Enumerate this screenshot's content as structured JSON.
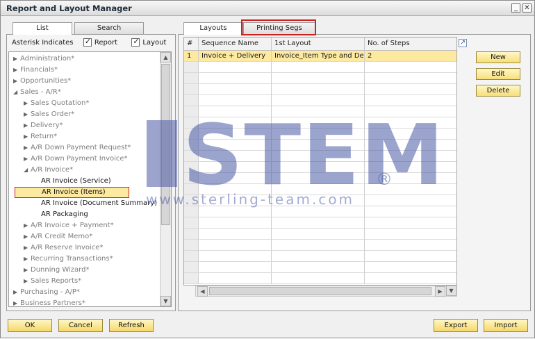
{
  "window": {
    "title": "Report and Layout Manager"
  },
  "left_tabs": {
    "list": "List",
    "search": "Search"
  },
  "asterisk": {
    "label": "Asterisk Indicates",
    "report": "Report",
    "layout": "Layout"
  },
  "tree": [
    {
      "label": "Administration*",
      "level": 0,
      "arrow": "▶",
      "tone": "grey"
    },
    {
      "label": "Financials*",
      "level": 0,
      "arrow": "▶",
      "tone": "grey"
    },
    {
      "label": "Opportunities*",
      "level": 0,
      "arrow": "▶",
      "tone": "grey"
    },
    {
      "label": "Sales - A/R*",
      "level": 0,
      "arrow": "◢",
      "tone": "grey"
    },
    {
      "label": "Sales Quotation*",
      "level": 1,
      "arrow": "▶",
      "tone": "grey"
    },
    {
      "label": "Sales Order*",
      "level": 1,
      "arrow": "▶",
      "tone": "grey"
    },
    {
      "label": "Delivery*",
      "level": 1,
      "arrow": "▶",
      "tone": "grey"
    },
    {
      "label": "Return*",
      "level": 1,
      "arrow": "▶",
      "tone": "grey"
    },
    {
      "label": "A/R Down Payment Request*",
      "level": 1,
      "arrow": "▶",
      "tone": "grey"
    },
    {
      "label": "A/R Down Payment Invoice*",
      "level": 1,
      "arrow": "▶",
      "tone": "grey"
    },
    {
      "label": "A/R Invoice*",
      "level": 1,
      "arrow": "◢",
      "tone": "grey"
    },
    {
      "label": "AR Invoice (Service)",
      "level": 2,
      "arrow": "",
      "tone": "dark"
    },
    {
      "label": "AR Invoice (Items)",
      "level": 2,
      "arrow": "",
      "tone": "dark",
      "selected": true
    },
    {
      "label": "AR Invoice (Document Summary)",
      "level": 2,
      "arrow": "",
      "tone": "dark"
    },
    {
      "label": "AR Packaging",
      "level": 2,
      "arrow": "",
      "tone": "dark"
    },
    {
      "label": "A/R Invoice + Payment*",
      "level": 1,
      "arrow": "▶",
      "tone": "grey"
    },
    {
      "label": "A/R Credit Memo*",
      "level": 1,
      "arrow": "▶",
      "tone": "grey"
    },
    {
      "label": "A/R Reserve Invoice*",
      "level": 1,
      "arrow": "▶",
      "tone": "grey"
    },
    {
      "label": "Recurring Transactions*",
      "level": 1,
      "arrow": "▶",
      "tone": "grey"
    },
    {
      "label": "Dunning Wizard*",
      "level": 1,
      "arrow": "▶",
      "tone": "grey"
    },
    {
      "label": "Sales Reports*",
      "level": 1,
      "arrow": "▶",
      "tone": "grey"
    },
    {
      "label": "Purchasing - A/P*",
      "level": 0,
      "arrow": "▶",
      "tone": "grey"
    },
    {
      "label": "Business Partners*",
      "level": 0,
      "arrow": "▶",
      "tone": "grey"
    }
  ],
  "right_tabs": {
    "layouts": "Layouts",
    "printing_segs": "Printing Segs"
  },
  "grid": {
    "headers": [
      "#",
      "Sequence Name",
      "1st Layout",
      "No. of Steps"
    ],
    "rows": [
      [
        "1",
        "Invoice + Delivery",
        "Invoice_Item Type and Detail",
        "2"
      ]
    ]
  },
  "side_buttons": {
    "new": "New",
    "edit": "Edit",
    "delete": "Delete"
  },
  "bottom_buttons": {
    "ok": "OK",
    "cancel": "Cancel",
    "refresh": "Refresh",
    "export": "Export",
    "import": "Import"
  },
  "watermark": {
    "brand": "STEM",
    "registered": "®",
    "url": "www.sterling-team.com"
  },
  "colors": {
    "selected_row": "#fde9a0",
    "button_fill": "#f7df7a",
    "highlight_box": "#d02020",
    "watermark": "#5566aa"
  }
}
